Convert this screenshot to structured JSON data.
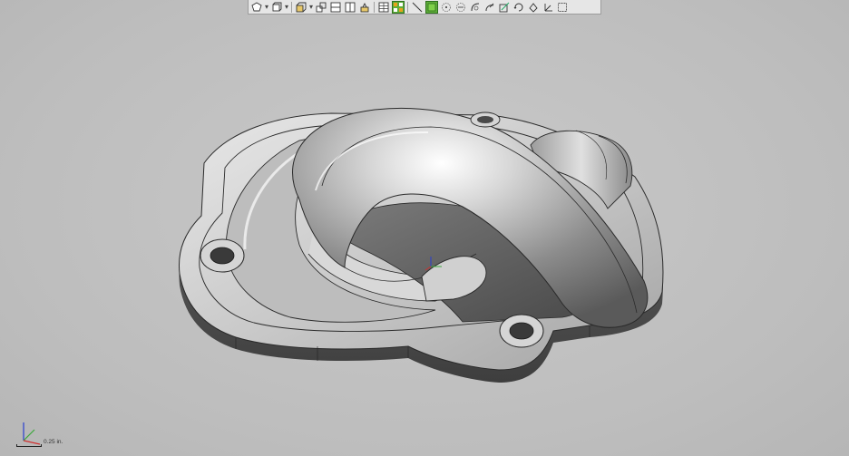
{
  "toolbar": {
    "buttons": [
      {
        "icon": "view-orientation-icon"
      },
      {
        "icon": "display-style-icon"
      },
      {
        "icon": "section-view-icon"
      },
      {
        "icon": "view-front-icon"
      },
      {
        "icon": "view-top-icon"
      },
      {
        "icon": "view-right-icon"
      },
      {
        "icon": "view-iso-icon"
      },
      {
        "icon": "grid-display-icon"
      },
      {
        "icon": "face-select-icon",
        "active": true
      },
      {
        "icon": "line-select-icon"
      },
      {
        "icon": "body-select-icon",
        "active": true
      },
      {
        "icon": "point-select-icon"
      },
      {
        "icon": "vertex-select-icon"
      },
      {
        "icon": "curve-select-icon"
      },
      {
        "icon": "measure-icon"
      },
      {
        "icon": "sketch-icon"
      },
      {
        "icon": "rotate-icon"
      },
      {
        "icon": "fill-icon"
      },
      {
        "icon": "axis-icon"
      },
      {
        "icon": "box-select-icon"
      }
    ]
  },
  "scale": {
    "label": "0.25 in."
  },
  "colors": {
    "background": "#c2c2c2",
    "model": "#a9a9a9",
    "active": "#5fae3a"
  }
}
